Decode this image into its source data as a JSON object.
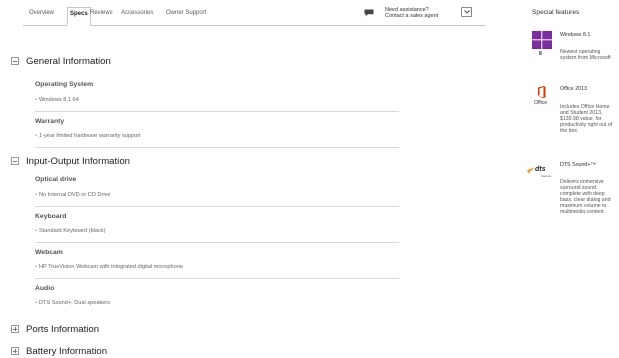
{
  "tabs": [
    {
      "label": "Overview"
    },
    {
      "label": "Specs"
    },
    {
      "label": "Reviews"
    },
    {
      "label": "Accessories"
    },
    {
      "label": "Owner Support"
    }
  ],
  "assistance": {
    "line1": "Need assistance?",
    "line2": "Contact a sales agent",
    "icon": "chat-bubble-icon",
    "toggle_icon": "chevron-down-icon"
  },
  "sections": {
    "general": {
      "title": "General Information",
      "expanded": true,
      "items": [
        {
          "title": "Operating System",
          "value": "Windows 8.1 64"
        },
        {
          "title": "Warranty",
          "value": "1-year limited hardware warranty support"
        }
      ]
    },
    "io": {
      "title": "Input-Output Information",
      "expanded": true,
      "items": [
        {
          "title": "Optical drive",
          "value": "No Internal DVD or CD Drive"
        },
        {
          "title": "Keyboard",
          "value": "Standard Keyboard (black)"
        },
        {
          "title": "Webcam",
          "value": "HP TrueVision Webcam with integrated digital microphone"
        },
        {
          "title": "Audio",
          "value": "DTS Sound+; Dual speakers"
        }
      ]
    },
    "ports": {
      "title": "Ports Information",
      "expanded": false
    },
    "battery": {
      "title": "Battery Information",
      "expanded": false
    }
  },
  "special_features": {
    "title": "Special features",
    "items": [
      {
        "name": "Windows 8.1",
        "logo_caption": "8",
        "description": "Newest operating system from Microsoft",
        "icon": "windows-logo-icon",
        "color": "#7b2ea3"
      },
      {
        "name": "Office 2013",
        "logo_caption": "Office",
        "description": "Includes Office Home and Student 2013, $139.98 value, for productivity right out of the box.",
        "icon": "office-logo-icon",
        "color": "#d83b01"
      },
      {
        "name": "DTS Sound+™",
        "logo_caption": "dts",
        "logo_sub": "Sound+",
        "description": "Delivers immersive surround sound complete with deep bass, clear dialog and maximum volume to multimedia content.",
        "icon": "dts-logo-icon",
        "color": "#f0a020"
      }
    ]
  },
  "colors": {
    "text": "#333333",
    "divider": "#d8d8d8",
    "windows_purple": "#7b2ea3",
    "office_orange": "#d83b01"
  }
}
